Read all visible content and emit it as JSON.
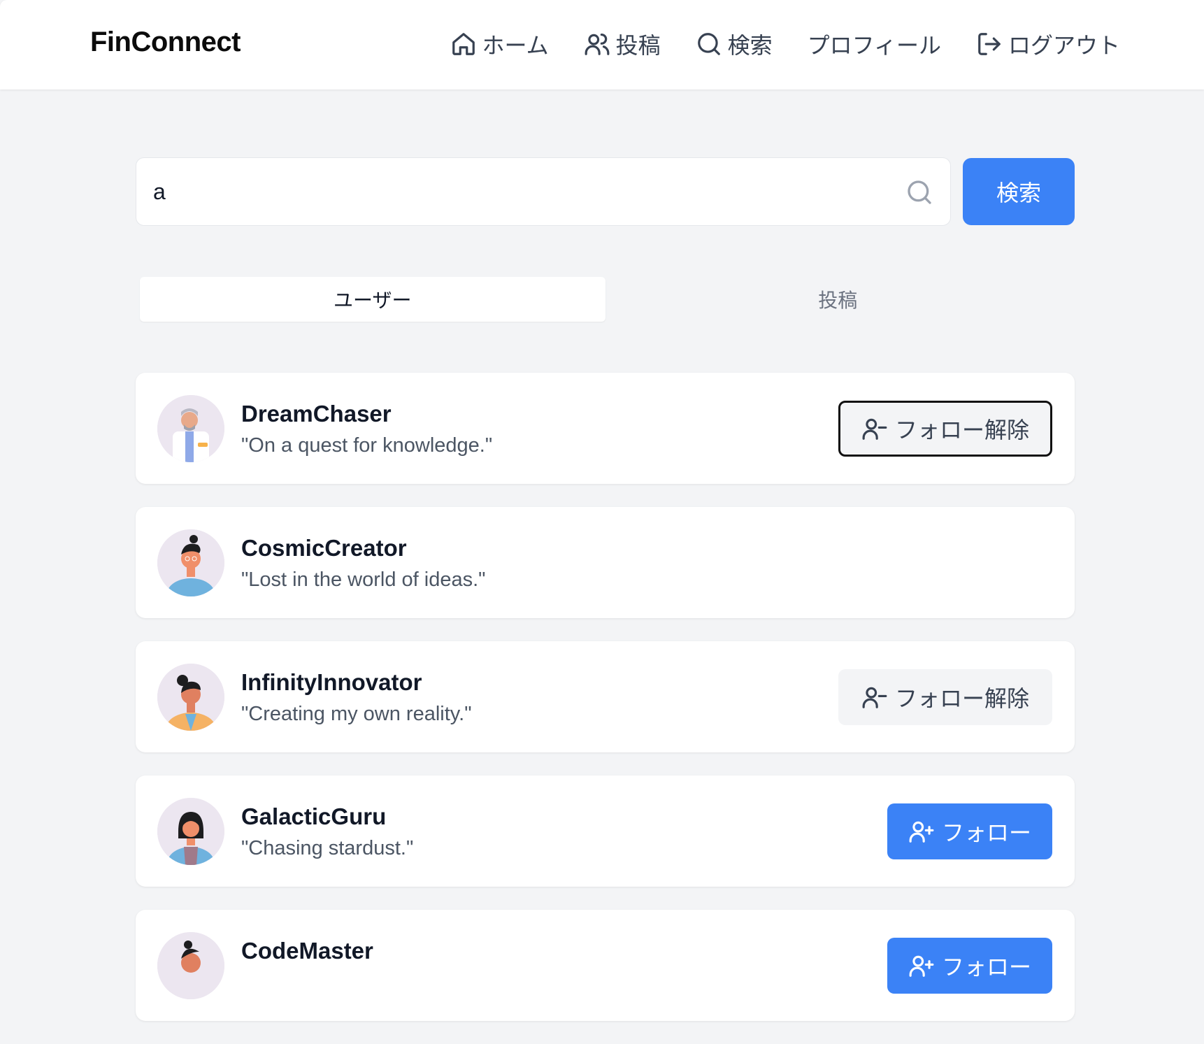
{
  "app": {
    "brand": "FinConnect"
  },
  "nav": [
    {
      "label": "ホーム",
      "icon": "home-icon"
    },
    {
      "label": "投稿",
      "icon": "users-icon"
    },
    {
      "label": "検索",
      "icon": "search-icon"
    },
    {
      "label": "プロフィール",
      "icon": ""
    },
    {
      "label": "ログアウト",
      "icon": "logout-icon"
    }
  ],
  "search": {
    "value": "a",
    "placeholder": "",
    "button_label": "検索"
  },
  "tabs": [
    {
      "label": "ユーザー",
      "active": true
    },
    {
      "label": "投稿",
      "active": false
    }
  ],
  "users": [
    {
      "name": "DreamChaser",
      "bio": "\"On a quest for knowledge.\"",
      "action": "unfollow",
      "action_label": "フォロー解除"
    },
    {
      "name": "CosmicCreator",
      "bio": "\"Lost in the world of ideas.\"",
      "action": "none",
      "action_label": ""
    },
    {
      "name": "InfinityInnovator",
      "bio": "\"Creating my own reality.\"",
      "action": "unfollow",
      "action_label": "フォロー解除"
    },
    {
      "name": "GalacticGuru",
      "bio": "\"Chasing stardust.\"",
      "action": "follow",
      "action_label": "フォロー"
    },
    {
      "name": "CodeMaster",
      "bio": "",
      "action": "follow",
      "action_label": "フォロー"
    }
  ],
  "colors": {
    "primary": "#3b82f6",
    "background": "#f3f4f6",
    "card": "#ffffff"
  }
}
